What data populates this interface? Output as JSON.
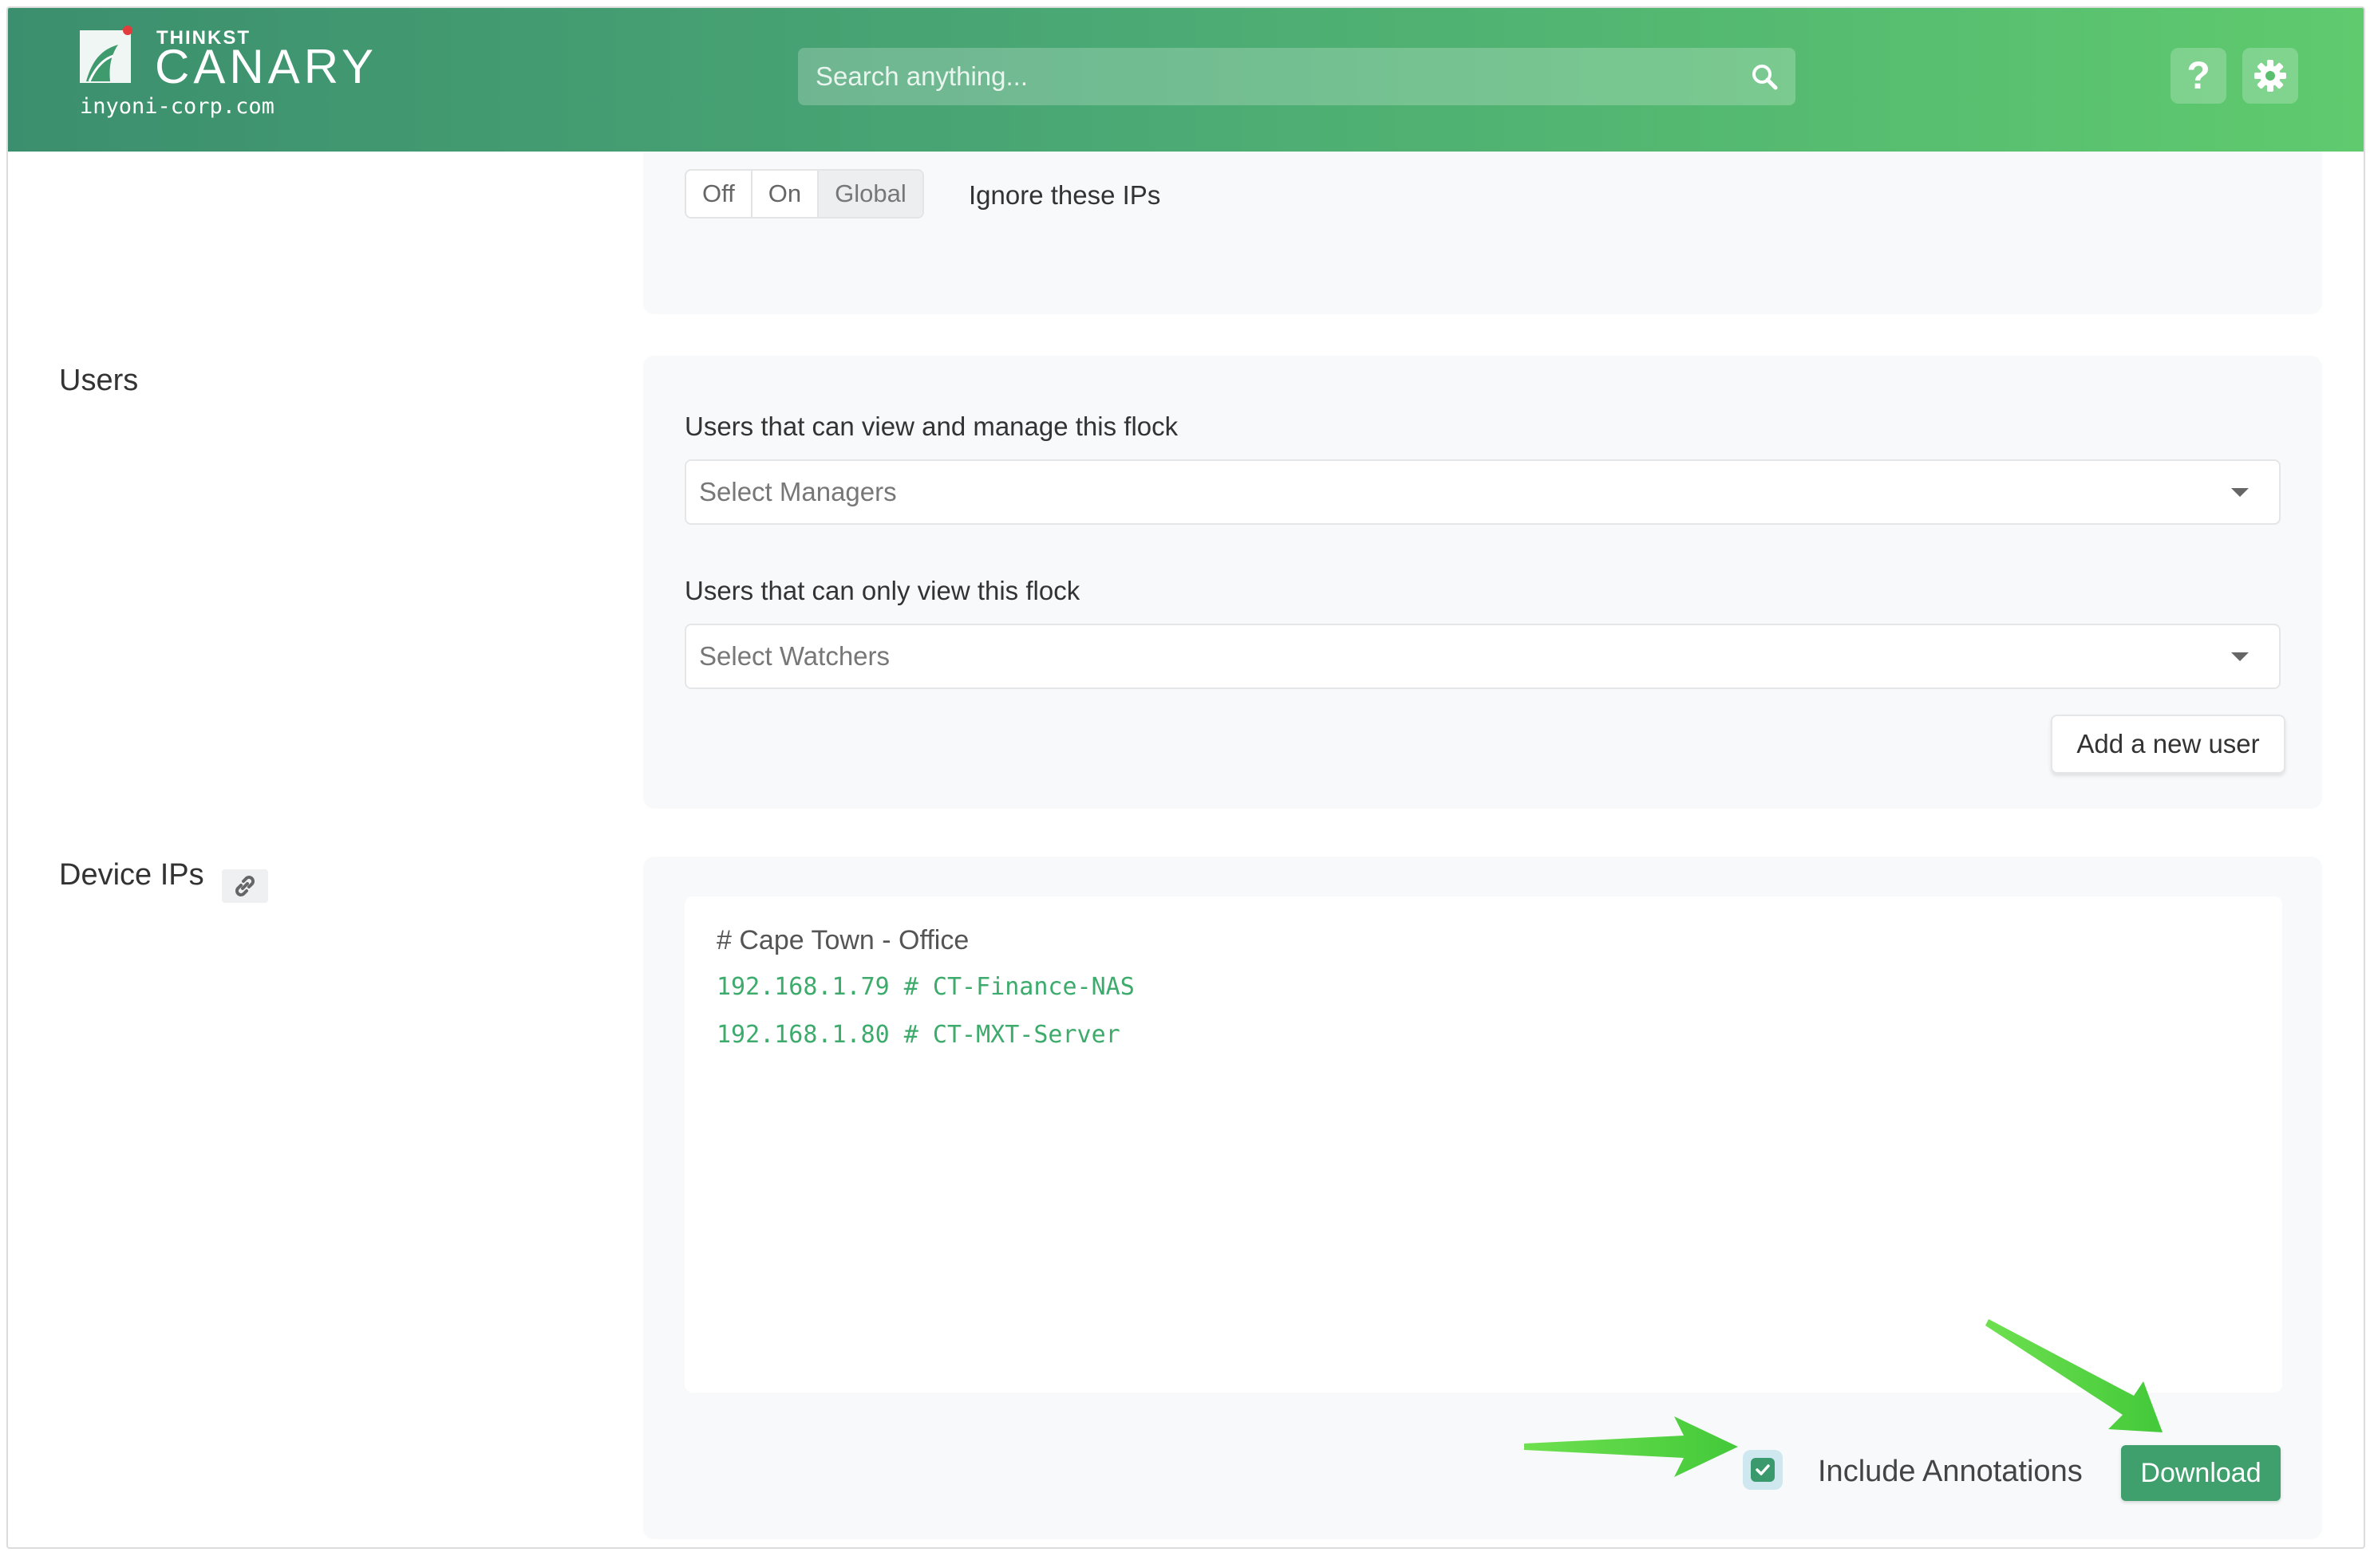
{
  "header": {
    "brand_small": "THINKST",
    "brand_big": "CANARY",
    "domain": "inyoni-corp.com",
    "search_placeholder": "Search anything...",
    "help_label": "?",
    "colors": {
      "gradient_start": "#3c8f6e",
      "gradient_end": "#5fca6e"
    }
  },
  "ignore_ips": {
    "options": [
      "Off",
      "On",
      "Global"
    ],
    "selected": "Global",
    "caption": "Ignore these IPs"
  },
  "users": {
    "section_title": "Users",
    "managers_label": "Users that can view and manage this flock",
    "managers_placeholder": "Select Managers",
    "watchers_label": "Users that can only view this flock",
    "watchers_placeholder": "Select Watchers",
    "add_user_label": "Add a new user"
  },
  "device_ips": {
    "section_title": "Device IPs",
    "comment": "# Cape Town - Office",
    "lines": [
      "192.168.1.79 # CT-Finance-NAS",
      "192.168.1.80 # CT-MXT-Server"
    ],
    "include_annotations_label": "Include Annotations",
    "include_annotations_checked": true,
    "download_label": "Download",
    "accent_color": "#3f9f6d"
  }
}
